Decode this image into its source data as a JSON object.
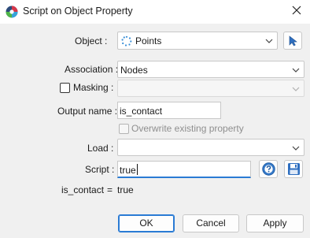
{
  "window": {
    "title": "Script on Object Property",
    "icons": {
      "app": "paraview-logo-icon",
      "close": "close-icon"
    }
  },
  "form": {
    "object_label": "Object :",
    "object_value": "Points",
    "object_icon": "points-icon",
    "pick_icon": "cursor-pick-icon",
    "association_label": "Association :",
    "association_value": "Nodes",
    "masking_label": "Masking :",
    "masking_checked": false,
    "masking_value": "",
    "output_name_label": "Output name :",
    "output_name_value": "is_contact",
    "overwrite_label": "Overwrite existing property",
    "overwrite_checked": false,
    "load_label": "Load :",
    "load_value": "",
    "script_label": "Script :",
    "script_value": "true",
    "help_icon": "help-icon",
    "save_icon": "save-icon",
    "result_name": "is_contact",
    "result_eq": "=",
    "result_value": "true"
  },
  "buttons": {
    "ok": "OK",
    "cancel": "Cancel",
    "apply": "Apply"
  },
  "colors": {
    "accent": "#2a7bd4",
    "help_blue": "#3478c8",
    "save_blue": "#2f6fc0"
  }
}
